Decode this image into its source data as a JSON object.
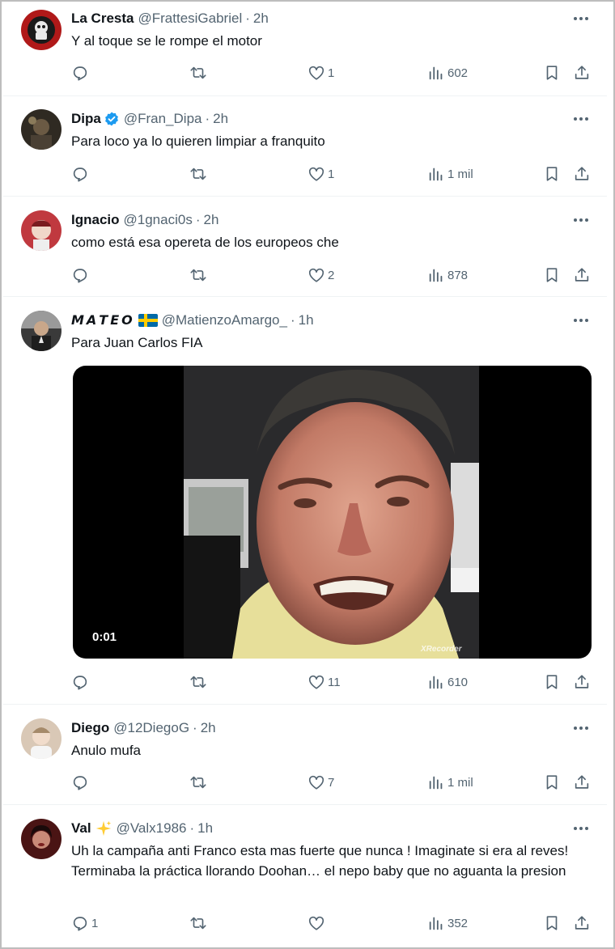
{
  "tweets": [
    {
      "name": "La Cresta",
      "handle": "@FrattesiGabriel",
      "time": "2h",
      "text": "Y al toque se le rompe el motor",
      "reply_count": "",
      "retweet_count": "",
      "like_count": "1",
      "views": "602",
      "avatar_color": "#b01919"
    },
    {
      "name": "Dipa",
      "handle": "@Fran_Dipa",
      "time": "2h",
      "text": "Para loco ya lo quieren limpiar a franquito",
      "reply_count": "",
      "retweet_count": "",
      "like_count": "1",
      "views": "1 mil",
      "verified": true,
      "avatar_color": "#2f2a22"
    },
    {
      "name": "Ignacio",
      "handle": "@1gnaci0s",
      "time": "2h",
      "text": "como está esa opereta de los europeos che",
      "reply_count": "",
      "retweet_count": "",
      "like_count": "2",
      "views": "878",
      "avatar_color": "#c0393f"
    },
    {
      "name": "𝙈𝘼𝙏𝙀𝙊",
      "flag": "sweden-flag-emoji",
      "handle": "@MatienzoAmargo_",
      "time": "1h",
      "text": "Para Juan Carlos FIA",
      "video_time": "0:01",
      "watermark": "XRecorder",
      "reply_count": "",
      "retweet_count": "",
      "like_count": "11",
      "views": "610",
      "avatar_color": "#3a3a3a"
    },
    {
      "name": "Diego",
      "handle": "@12DiegoG",
      "time": "2h",
      "text": "Anulo mufa",
      "reply_count": "",
      "retweet_count": "",
      "like_count": "7",
      "views": "1 mil",
      "avatar_color": "#d9c8b6"
    },
    {
      "name": "Val",
      "badge": "sparkles-emoji",
      "handle": "@Valx1986",
      "time": "1h",
      "text": "Uh la campaña anti Franco esta mas fuerte que nunca ! Imaginate si era al reves! Terminaba la práctica llorando Doohan… el nepo baby que no aguanta la presion",
      "reply_count": "1",
      "retweet_count": "",
      "like_count": "",
      "views": "352",
      "avatar_color": "#4a1414"
    }
  ],
  "colors": {
    "text": "#0f1419",
    "secondary": "#536471",
    "divider": "#eff3f4",
    "verified": "#1d9bf0"
  }
}
